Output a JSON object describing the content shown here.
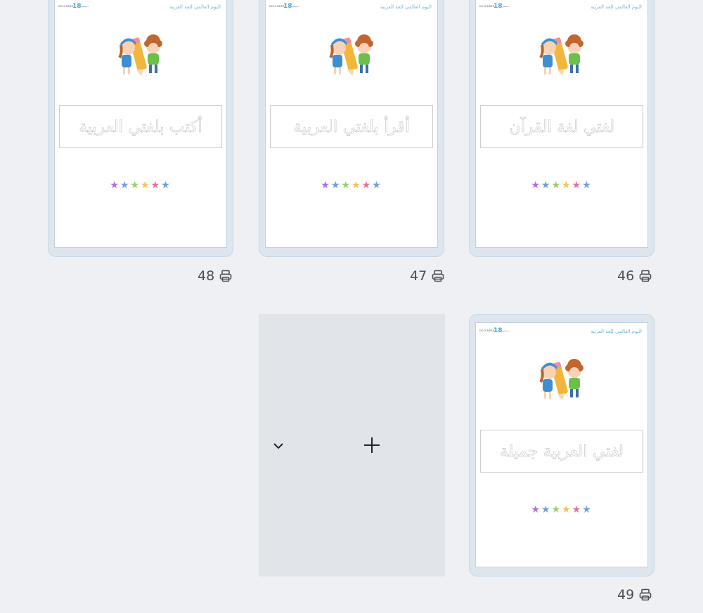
{
  "pages": [
    {
      "number": "48",
      "trace_text": "أكتب بلغتي العربية",
      "day": "18",
      "header_left": "DECEMBER",
      "header_left2": "ديسمبر",
      "header_right": "اليوم العالمي للغة العربية"
    },
    {
      "number": "47",
      "trace_text": "أقرأ بلغتي العربية",
      "day": "18",
      "header_left": "DECEMBER",
      "header_left2": "ديسمبر",
      "header_right": "اليوم العالمي للغة العربية"
    },
    {
      "number": "46",
      "trace_text": "لغتي لغة القرآن",
      "day": "18",
      "header_left": "DECEMBER",
      "header_left2": "ديسمبر",
      "header_right": "اليوم العالمي للغة العربية"
    },
    {
      "number": "49",
      "trace_text": "لغتي العربية جميلة",
      "day": "18",
      "header_left": "DECEMBER",
      "header_left2": "ديسمبر",
      "header_right": "اليوم العالمي للغة العربية"
    }
  ],
  "star_colors": [
    "#b06fe0",
    "#6fa0d8",
    "#9ad06a",
    "#f4c45a",
    "#e8709a",
    "#6fa0d8"
  ],
  "icons": {
    "print": "printer-icon",
    "expand": "chevron-down-icon",
    "add": "plus-icon"
  }
}
